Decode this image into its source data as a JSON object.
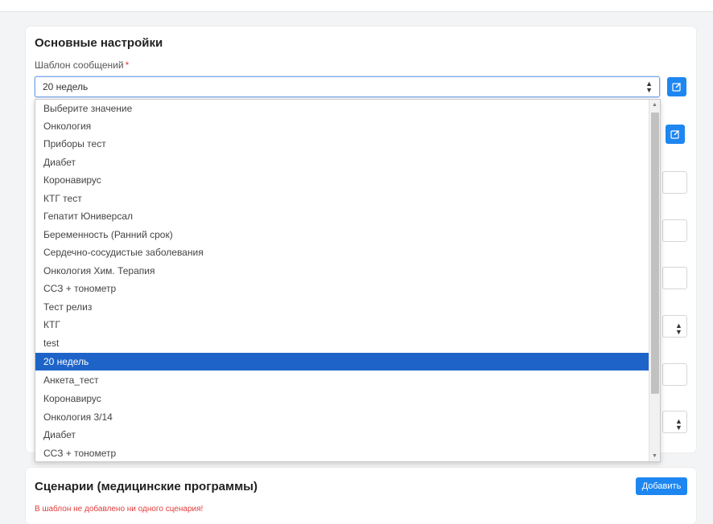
{
  "main_section": {
    "title": "Основные настройки",
    "template_label": "Шаблон сообщений",
    "required_mark": "*",
    "template_selected": "20 недель",
    "options": [
      "Выберите значение",
      "Онкология",
      "Приборы тест",
      "Диабет",
      "Коронавирус",
      "КТГ тест",
      "Гепатит Юниверсал",
      "Беременность (Ранний срок)",
      "Сердечно-сосудистые заболевания",
      "Онкология Хим. Терапия",
      "ССЗ + тонометр",
      "Тест релиз",
      "КТГ",
      "test",
      "20 недель",
      "Анкета_тест",
      "Коронавирус",
      "Онкология 3/14",
      "Диабет",
      "ССЗ + тонометр"
    ]
  },
  "scenarios": {
    "title": "Сценарии (медицинские программы)",
    "add_label": "Добавить",
    "empty_warning": "В шаблон не добавлено ни одного сценария!"
  },
  "icons": {
    "edit": "edit-icon",
    "select_arrows": "sort-arrows-icon"
  },
  "colors": {
    "accent": "#1e86f0",
    "selected_option": "#1e64c8",
    "required": "#e23b3b",
    "warning": "#e03c3c"
  }
}
